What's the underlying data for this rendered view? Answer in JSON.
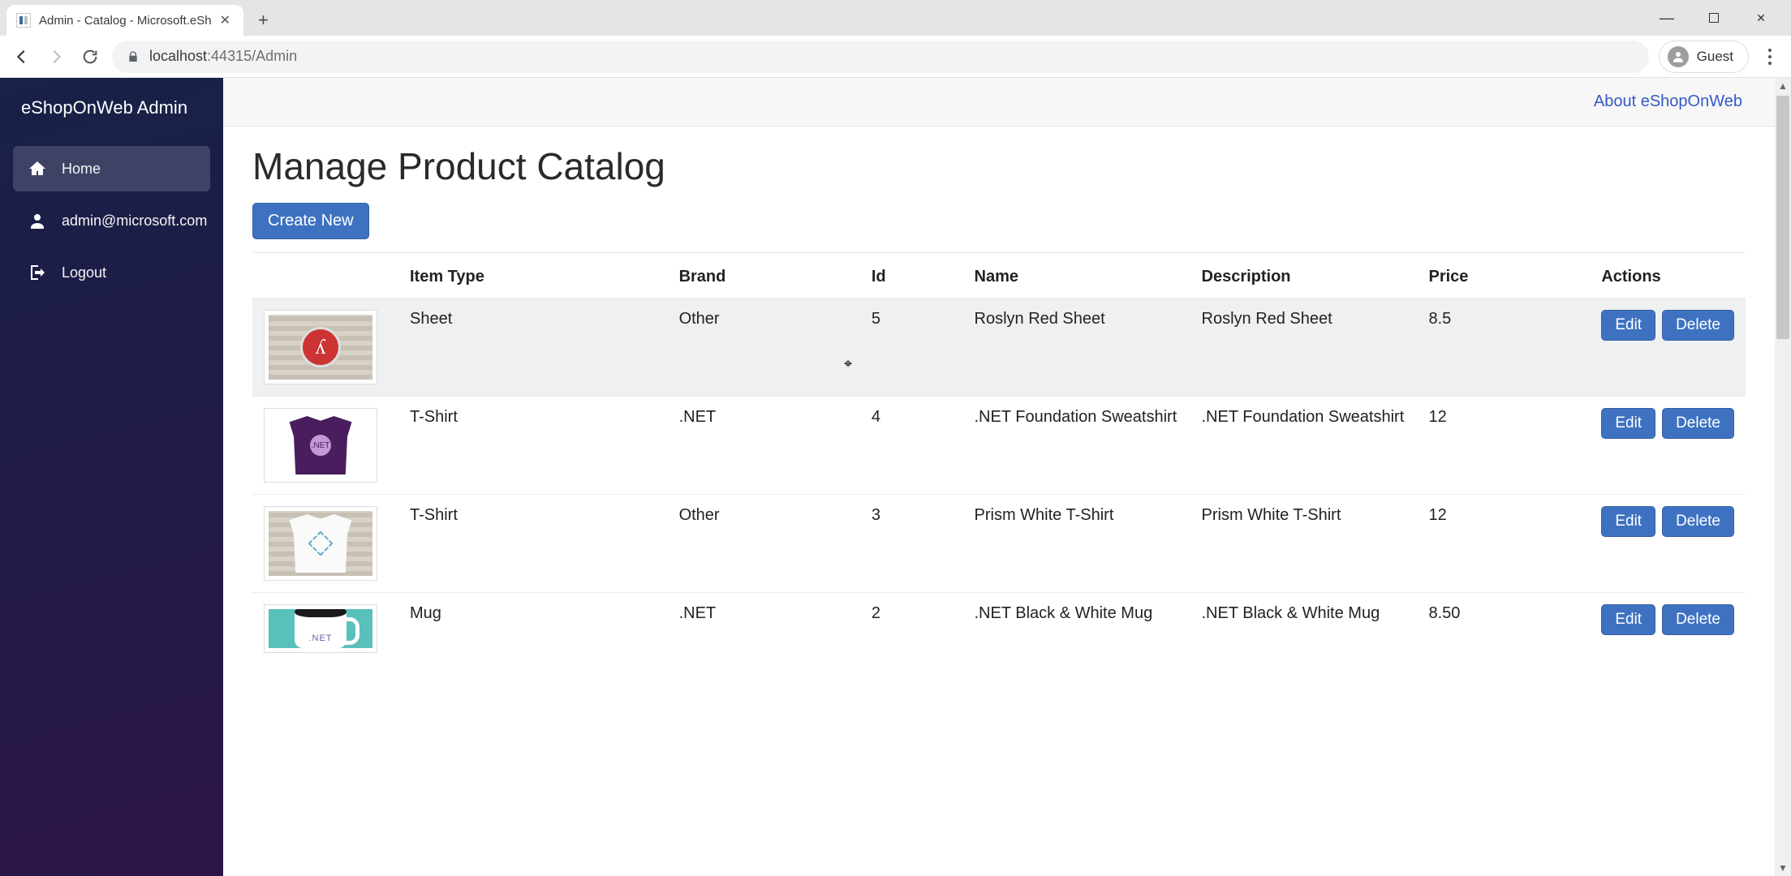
{
  "browser": {
    "tab_title": "Admin - Catalog - Microsoft.eSh",
    "url_host": "localhost",
    "url_path": ":44315/Admin",
    "guest_label": "Guest"
  },
  "sidebar": {
    "brand": "eShopOnWeb Admin",
    "items": [
      {
        "label": "Home"
      },
      {
        "label": "admin@microsoft.com"
      },
      {
        "label": "Logout"
      }
    ]
  },
  "header": {
    "about_link": "About eShopOnWeb"
  },
  "page": {
    "title": "Manage Product Catalog",
    "create_label": "Create New"
  },
  "table": {
    "headers": {
      "item_type": "Item Type",
      "brand": "Brand",
      "id": "Id",
      "name": "Name",
      "description": "Description",
      "price": "Price",
      "actions": "Actions"
    },
    "action_labels": {
      "edit": "Edit",
      "delete": "Delete"
    },
    "rows": [
      {
        "item_type": "Sheet",
        "brand": "Other",
        "id": "5",
        "name": "Roslyn Red Sheet",
        "description": "Roslyn Red Sheet",
        "price": "8.5",
        "thumb": "roslyn"
      },
      {
        "item_type": "T-Shirt",
        "brand": ".NET",
        "id": "4",
        "name": ".NET Foundation Sweatshirt",
        "description": ".NET Foundation Sweatshirt",
        "price": "12",
        "thumb": "net-sweat"
      },
      {
        "item_type": "T-Shirt",
        "brand": "Other",
        "id": "3",
        "name": "Prism White T-Shirt",
        "description": "Prism White T-Shirt",
        "price": "12",
        "thumb": "prism"
      },
      {
        "item_type": "Mug",
        "brand": ".NET",
        "id": "2",
        "name": ".NET Black & White Mug",
        "description": ".NET Black & White Mug",
        "price": "8.50",
        "thumb": "mug"
      }
    ]
  }
}
